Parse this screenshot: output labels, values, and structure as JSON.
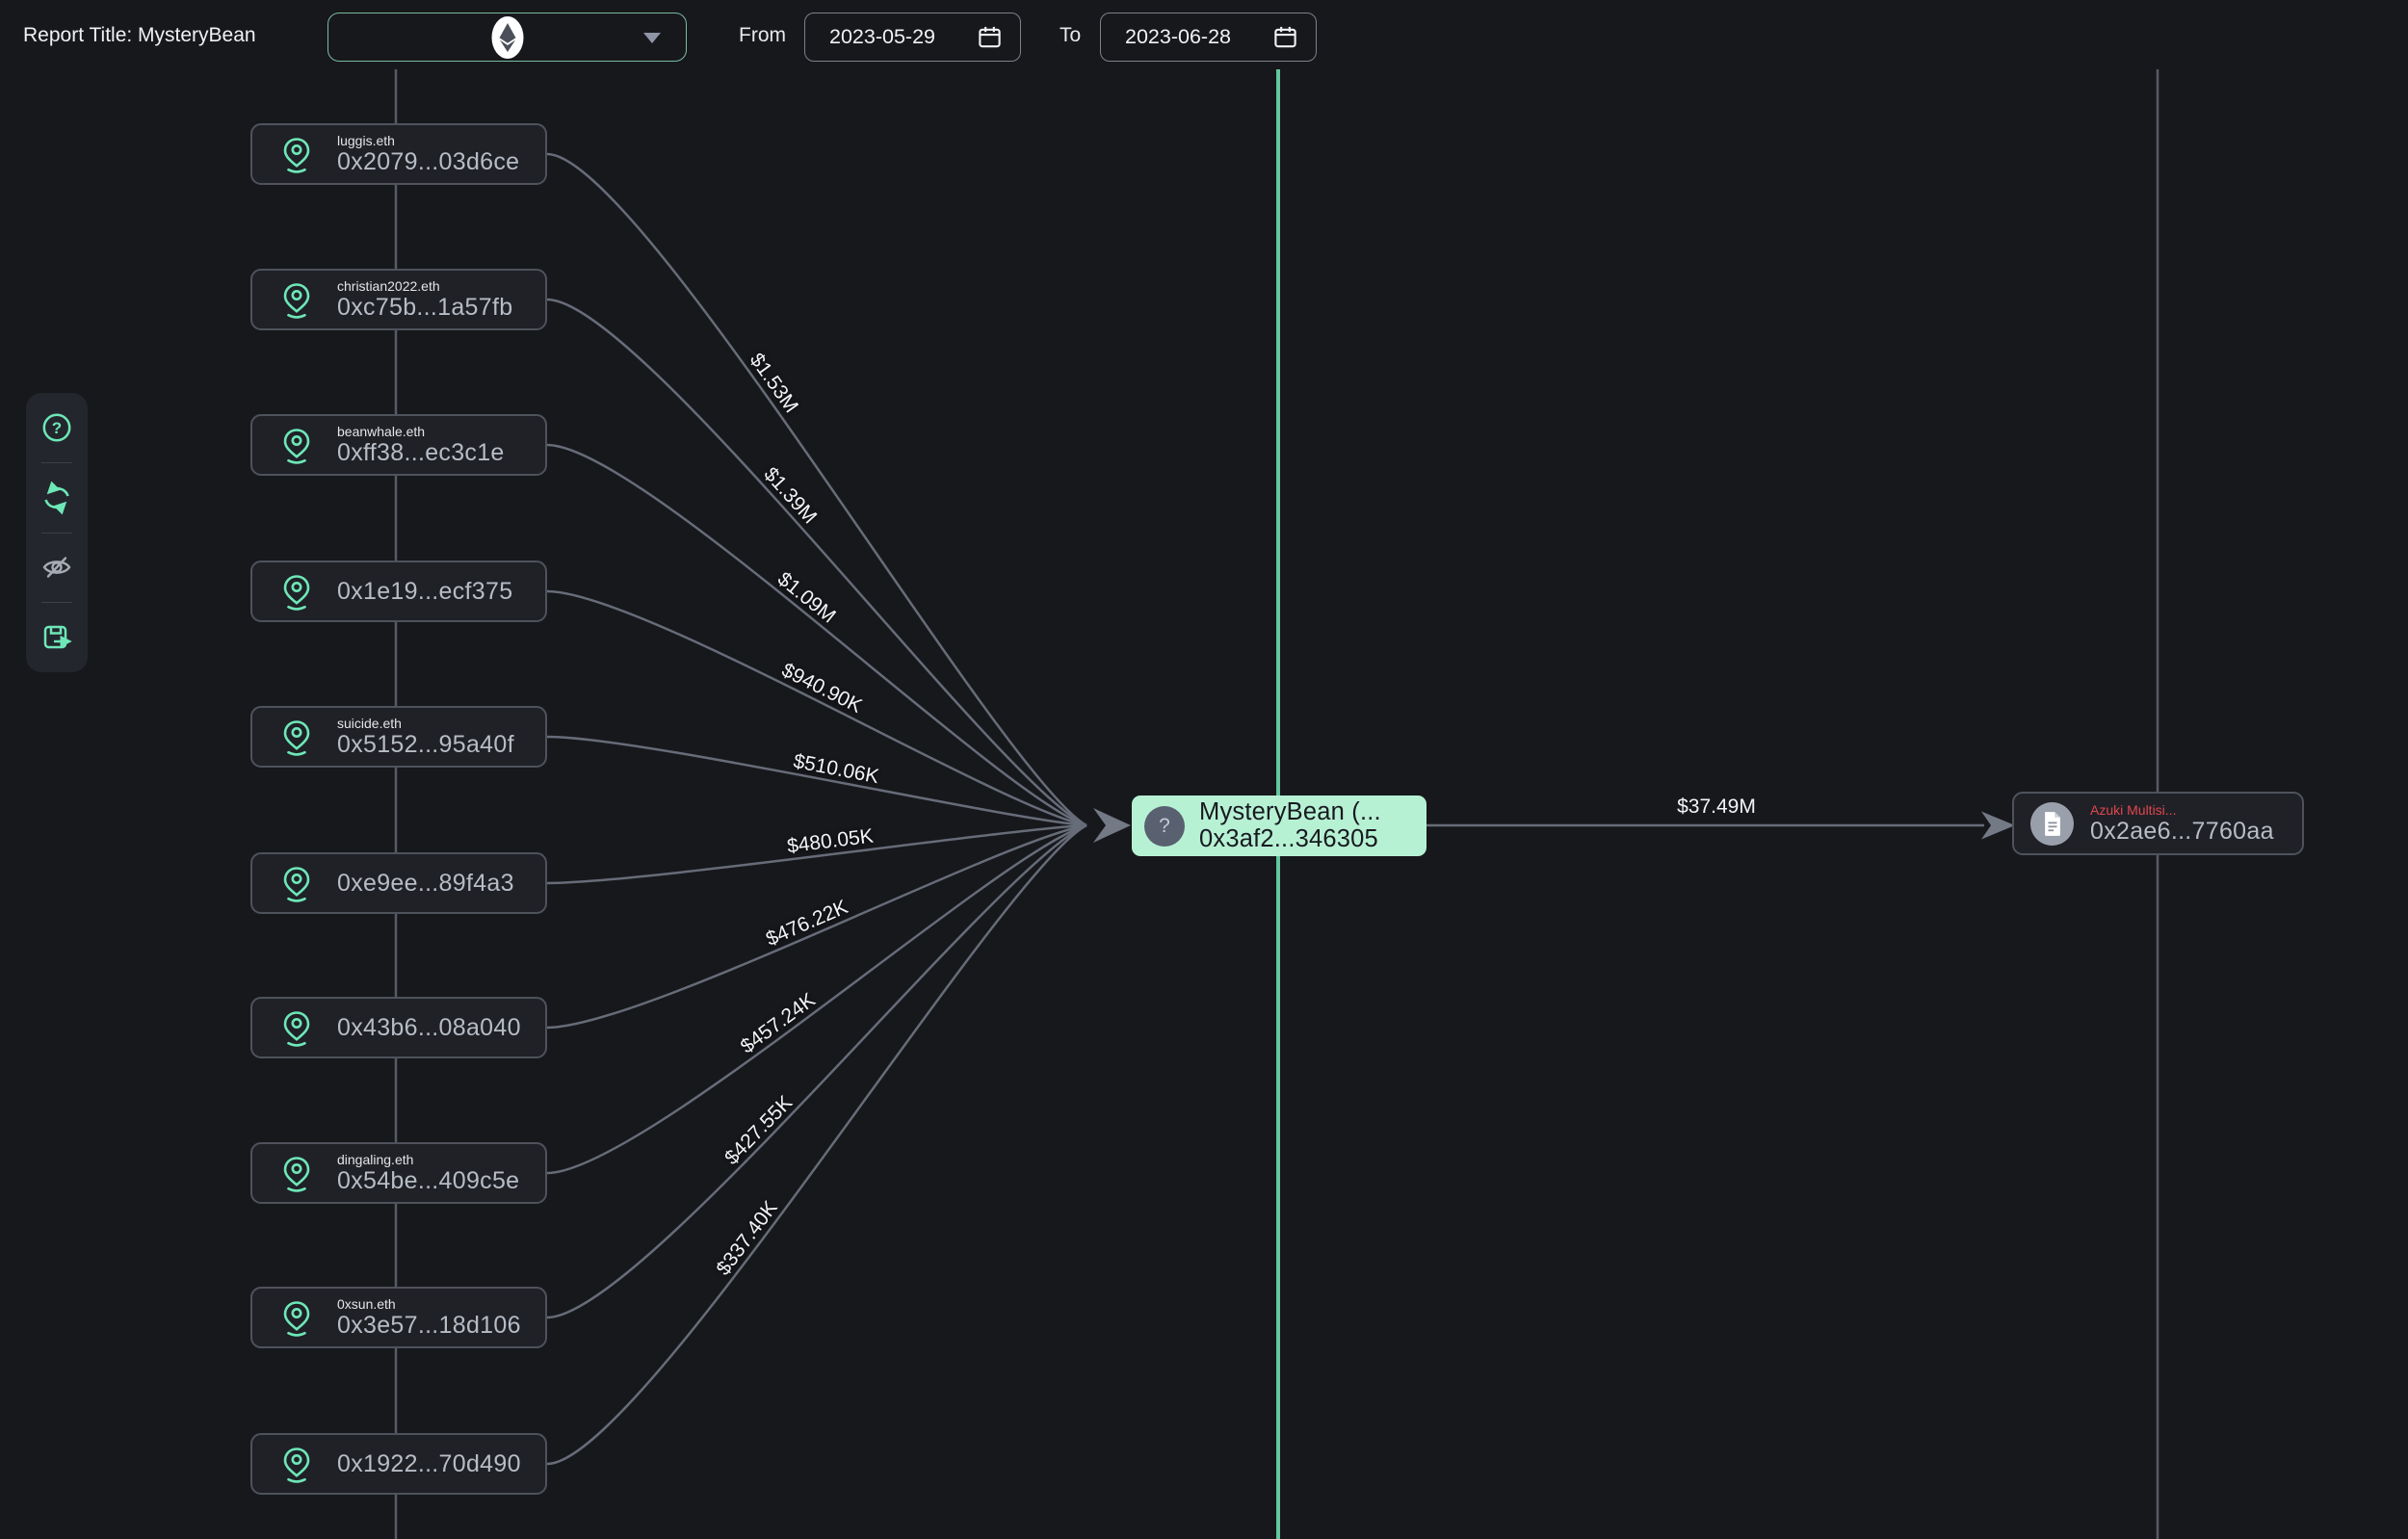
{
  "header": {
    "report_title": "Report Title: MysteryBean",
    "chain_selector": {
      "selected_chain": "ethereum"
    },
    "from_label": "From",
    "from_date": "2023-05-29",
    "to_label": "To",
    "to_date": "2023-06-28"
  },
  "toolrail": {
    "items": [
      {
        "name": "help",
        "icon": "question-circle-icon"
      },
      {
        "name": "refresh",
        "icon": "refresh-icon"
      },
      {
        "name": "hide",
        "icon": "eye-off-icon"
      },
      {
        "name": "export",
        "icon": "save-export-icon"
      }
    ]
  },
  "graph": {
    "source_nodes": [
      {
        "name": "luggis.eth",
        "address": "0x2079...03d6ce",
        "amount": "$1.53M"
      },
      {
        "name": "christian2022.eth",
        "address": "0xc75b...1a57fb",
        "amount": "$1.39M"
      },
      {
        "name": "beanwhale.eth",
        "address": "0xff38...ec3c1e",
        "amount": "$1.09M"
      },
      {
        "name": "",
        "address": "0x1e19...ecf375",
        "amount": "$940.90K"
      },
      {
        "name": "suicide.eth",
        "address": "0x5152...95a40f",
        "amount": "$510.06K"
      },
      {
        "name": "",
        "address": "0xe9ee...89f4a3",
        "amount": "$480.05K"
      },
      {
        "name": "",
        "address": "0x43b6...08a040",
        "amount": "$476.22K"
      },
      {
        "name": "dingaling.eth",
        "address": "0x54be...409c5e",
        "amount": "$457.24K"
      },
      {
        "name": "0xsun.eth",
        "address": "0x3e57...18d106",
        "amount": "$427.55K"
      },
      {
        "name": "",
        "address": "0x1922...70d490",
        "amount": "$337.40K"
      }
    ],
    "central_node": {
      "name": "MysteryBean (...",
      "address": "0x3af2...346305",
      "avatar_glyph": "?"
    },
    "outgoing_edge": {
      "amount": "$37.49M"
    },
    "target_node": {
      "name": "Azuki Multisi...",
      "address": "0x2ae6...7760aa"
    }
  },
  "colors": {
    "accent_green": "#6ee7b7",
    "highlight_node_bg": "#b7f1d4",
    "alert_red": "#e0474d",
    "edge_gray": "#666c78",
    "timeline_green": "#63c7a0"
  }
}
